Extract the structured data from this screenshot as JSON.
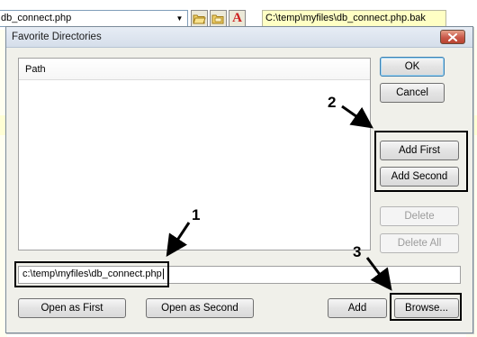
{
  "background": {
    "file_combo_value": "db_connect.php",
    "path_field_value": "C:\\temp\\myfiles\\db_connect.php.bak",
    "toolbar_icons": [
      "open-folder-icon",
      "folder-icon",
      "font-a-icon"
    ],
    "colors": {
      "path_field_bg": "#ffffc4",
      "font_icon": "#cc1f1f"
    }
  },
  "dialog": {
    "title": "Favorite Directories",
    "list": {
      "column_header": "Path",
      "items": []
    },
    "path_input_value": "c:\\temp\\myfiles\\db_connect.php",
    "buttons": {
      "ok": "OK",
      "cancel": "Cancel",
      "add_first": "Add First",
      "add_second": "Add Second",
      "delete": "Delete",
      "delete_all": "Delete All",
      "open_as_first": "Open as First",
      "open_as_second": "Open as Second",
      "add": "Add",
      "browse": "Browse..."
    }
  },
  "annotations": {
    "callout_1": "1",
    "callout_2": "2",
    "callout_3": "3"
  }
}
